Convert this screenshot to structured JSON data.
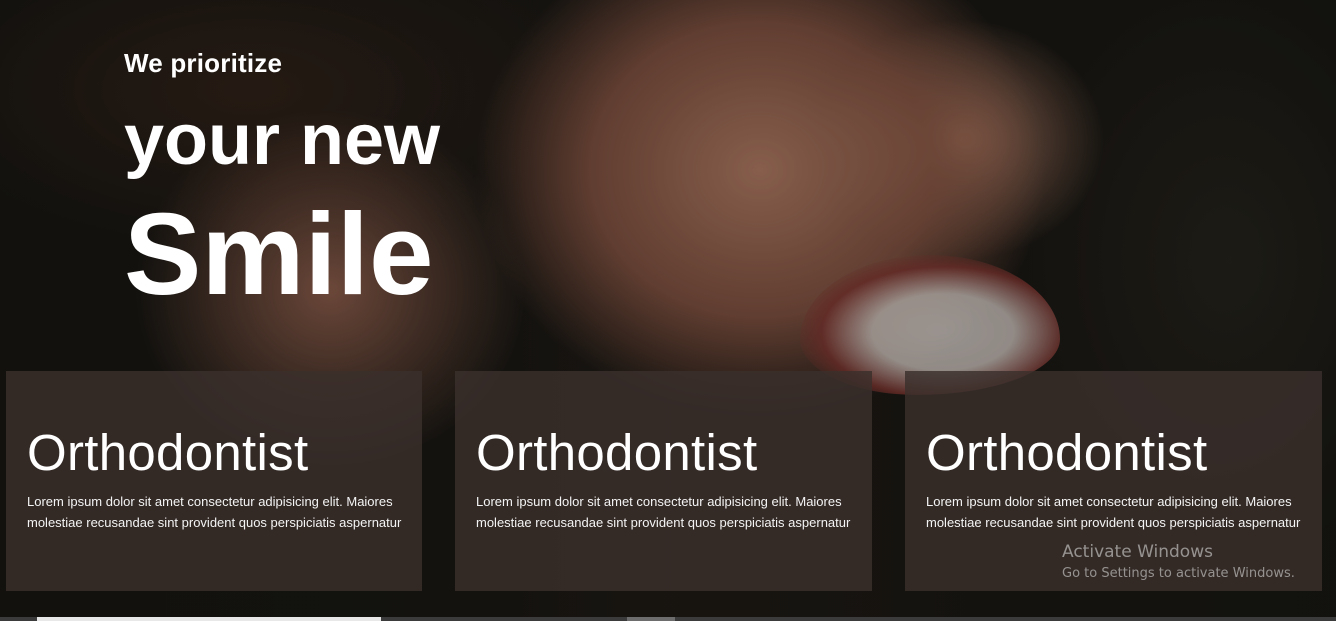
{
  "hero": {
    "tagline": "We prioritize",
    "line2": "your new",
    "line3": "Smile"
  },
  "cards": [
    {
      "title": "Orthodontist",
      "body": "Lorem ipsum dolor sit amet consectetur adipisicing elit. Maiores molestiae recusandae sint provident quos perspiciatis aspernatur"
    },
    {
      "title": "Orthodontist",
      "body": "Lorem ipsum dolor sit amet consectetur adipisicing elit. Maiores molestiae recusandae sint provident quos perspiciatis aspernatur"
    },
    {
      "title": "Orthodontist",
      "body": "Lorem ipsum dolor sit amet consectetur adipisicing elit. Maiores molestiae recusandae sint provident quos perspiciatis aspernatur"
    }
  ],
  "watermark": {
    "title": "Activate Windows",
    "subtitle": "Go to Settings to activate Windows."
  },
  "colors": {
    "text": "#ffffff",
    "card_bg": "#3a302c",
    "watermark": "#d2d2d2"
  }
}
